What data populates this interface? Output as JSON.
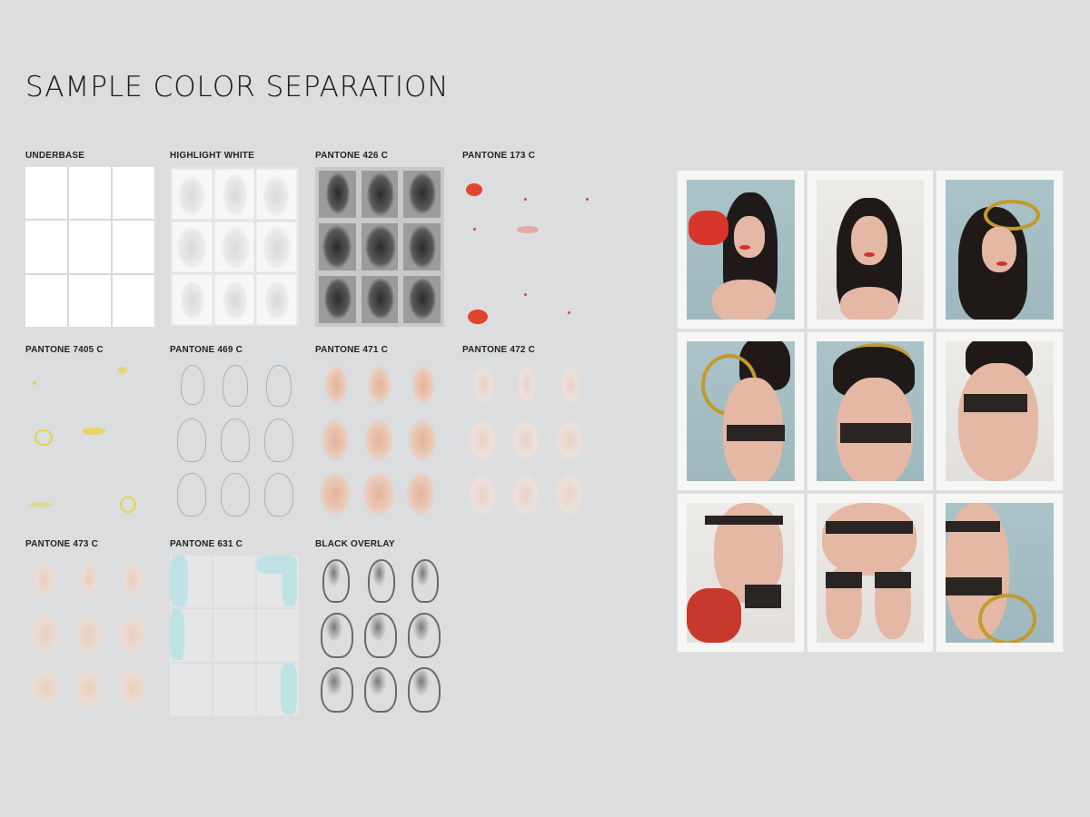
{
  "title": "SAMPLE COLOR SEPARATION",
  "separations": [
    {
      "label": "UNDERBASE"
    },
    {
      "label": "HIGHLIGHT WHITE"
    },
    {
      "label": "PANTONE 426 C"
    },
    {
      "label": "PANTONE 173 C"
    },
    {
      "label": "PANTONE 7405 C"
    },
    {
      "label": "PANTONE 469 C"
    },
    {
      "label": "PANTONE 471 C"
    },
    {
      "label": "PANTONE 472 C"
    },
    {
      "label": "PANTONE 473 C"
    },
    {
      "label": "PANTONE 631 C"
    },
    {
      "label": "BLACK OVERLAY"
    }
  ],
  "colors": {
    "background": "#dcdddf",
    "pantone_173": "#e0452f",
    "pantone_7405": "#e8d24a",
    "pantone_631": "#bfe2e6",
    "lips": "#d2322a",
    "gold": "#c49a2a"
  }
}
